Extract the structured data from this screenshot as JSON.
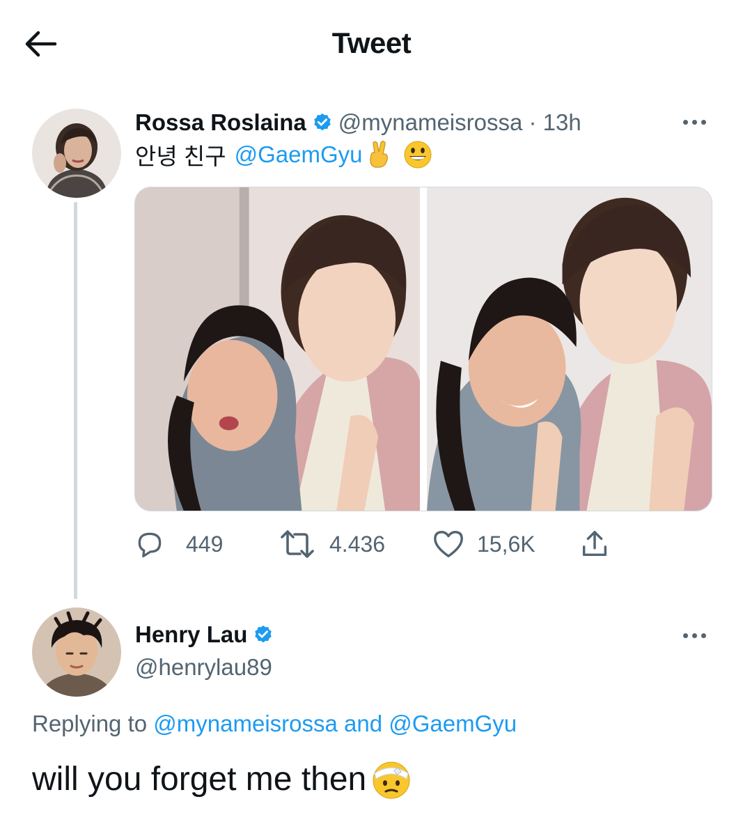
{
  "header": {
    "title": "Tweet"
  },
  "tweet1": {
    "display_name": "Rossa Roslaina",
    "handle_time": "@mynameisrossa · 13h",
    "text_korean": "안녕 친구",
    "mention": "@GaemGyu",
    "emojis": [
      "victory-hand-emoji",
      "grinning-face-emoji"
    ],
    "stats": {
      "replies": "449",
      "retweets": "4.436",
      "likes": "15,6K"
    }
  },
  "tweet2": {
    "display_name": "Henry Lau",
    "handle": "@henrylau89",
    "replying_prefix": "Replying to",
    "replying_user1": "@mynameisrossa",
    "replying_and": "and",
    "replying_user2": "@GaemGyu",
    "text": "will you forget me then",
    "emoji": "face-with-head-bandage-emoji"
  },
  "colors": {
    "link": "#1d9bf0",
    "secondary_text": "#536471",
    "verified": "#1d9bf0",
    "border": "#cfd9de"
  }
}
